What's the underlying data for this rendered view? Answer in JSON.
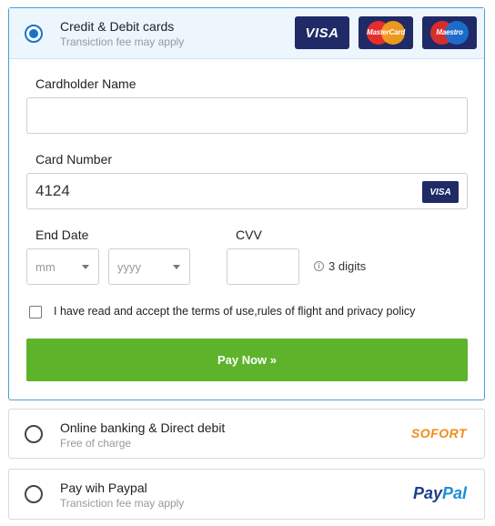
{
  "card_option": {
    "title": "Credit & Debit cards",
    "subtitle": "Transiction fee may apply",
    "logos": {
      "visa": "VISA",
      "mastercard": "MasterCard",
      "maestro": "Maestro"
    }
  },
  "form": {
    "cardholder_label": "Cardholder Name",
    "cardholder_value": "",
    "card_number_label": "Card Number",
    "card_number_value": "4124",
    "card_brand": "VISA",
    "end_date_label": "End Date",
    "month_placeholder": "mm",
    "year_placeholder": "yyyy",
    "cvv_label": "CVV",
    "cvv_value": "",
    "cvv_hint": "3 digits",
    "terms_text": "I have read and accept the terms of use,rules of flight  and privacy policy",
    "terms_checked": false,
    "pay_button": "Pay Now »"
  },
  "bank_option": {
    "title": "Online banking & Direct debit",
    "subtitle": "Free of charge",
    "logo": "SOFORT"
  },
  "paypal_option": {
    "title": "Pay wih Paypal",
    "subtitle": "Transiction fee may apply",
    "logo_part1": "Pay",
    "logo_part2": "Pal"
  },
  "colors": {
    "accent_blue": "#1a73c9",
    "button_green": "#5db42b",
    "card_navy": "#1f2a66",
    "sofort_orange": "#f08c1a"
  },
  "icons": [
    "radio-selected-icon",
    "radio-empty-icon",
    "info-icon",
    "chevron-down-icon"
  ]
}
